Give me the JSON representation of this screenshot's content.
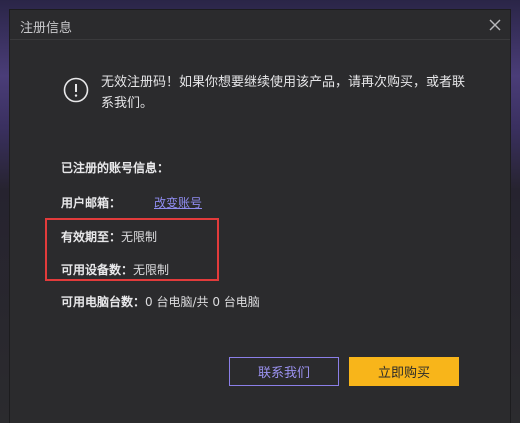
{
  "dialog": {
    "title": "注册信息",
    "close_icon": "close-icon"
  },
  "alert": {
    "icon": "exclamation-circle-icon",
    "message": "无效注册码！如果你想要继续使用该产品，请再次购买，或者联系我们。"
  },
  "account": {
    "heading": "已注册的账号信息：",
    "email_label": "用户邮箱：",
    "change_account_link": "改变账号",
    "validity_label": "有效期至：",
    "validity_value": "无限制",
    "devices_label": "可用设备数：",
    "devices_value": "无限制",
    "computers_label": "可用电脑台数：",
    "computers_value": "0 台电脑/共 0 台电脑"
  },
  "buttons": {
    "contact_label": "联系我们",
    "buy_label": "立即购买"
  },
  "colors": {
    "highlight_border": "#e23b3b",
    "buy_button": "#f8b51a",
    "contact_button_border": "#8b7fe8",
    "link": "#8f8cf0"
  }
}
